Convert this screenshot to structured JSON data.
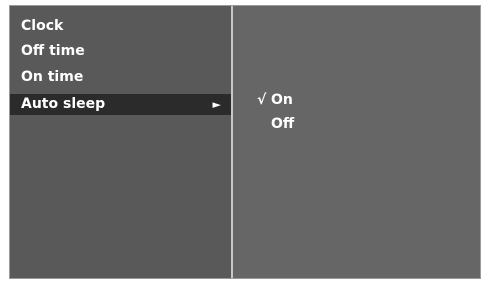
{
  "menu": {
    "items": [
      {
        "label": "Clock"
      },
      {
        "label": "Off time"
      },
      {
        "label": "On time"
      },
      {
        "label": "Auto sleep",
        "arrow": "►"
      }
    ]
  },
  "submenu": {
    "options": [
      {
        "label": "On",
        "check": "√"
      },
      {
        "label": "Off",
        "check": ""
      }
    ]
  },
  "colors": {
    "panel_left": "#595959",
    "panel_right": "#666666",
    "selected_bg": "#2b2b2b",
    "text": "#ffffff"
  }
}
